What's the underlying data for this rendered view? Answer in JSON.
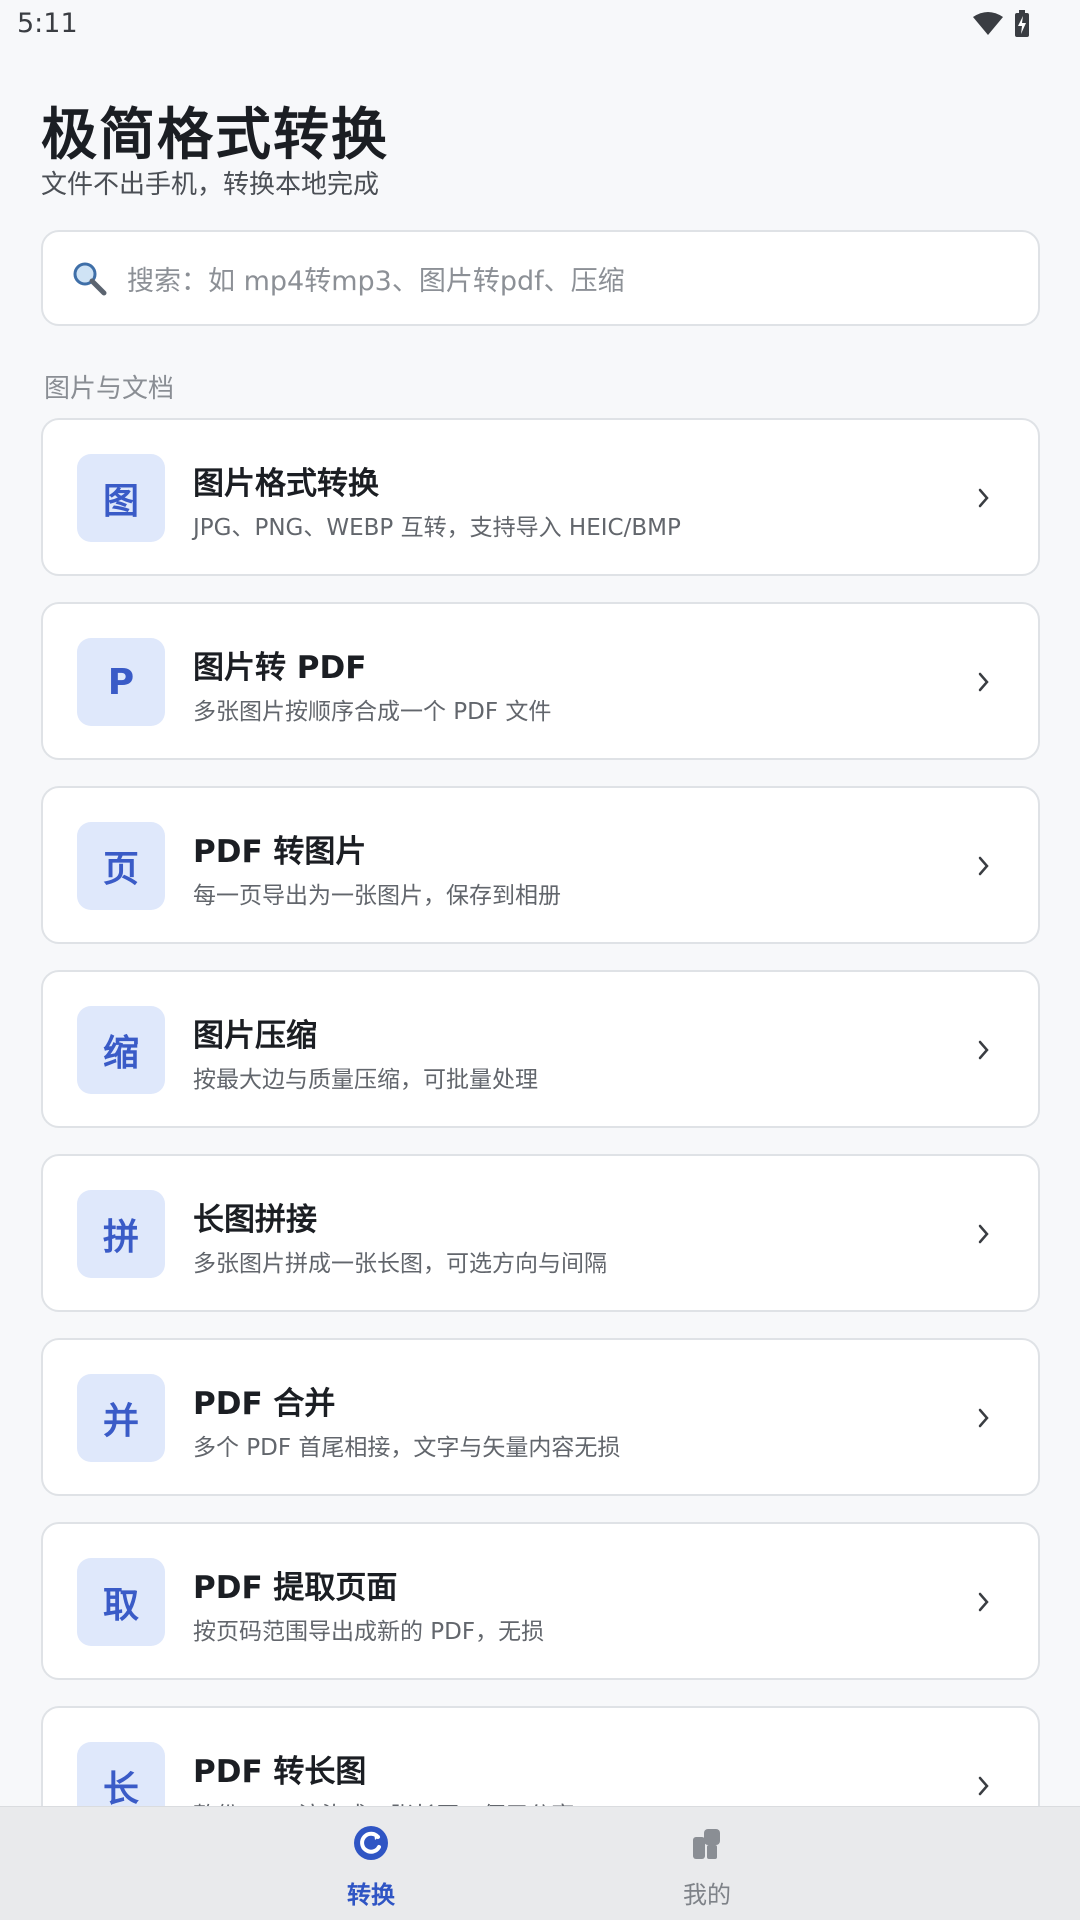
{
  "status_bar": {
    "time": "5:11"
  },
  "header": {
    "title": "极简格式转换",
    "subtitle": "文件不出手机，转换本地完成"
  },
  "search": {
    "placeholder": "搜索：如 mp4转mp3、图片转pdf、压缩"
  },
  "section": {
    "title": "图片与文档"
  },
  "tools": [
    {
      "badge": "图",
      "title": "图片格式转换",
      "desc": "JPG、PNG、WEBP 互转，支持导入 HEIC/BMP"
    },
    {
      "badge": "P",
      "title": "图片转 PDF",
      "desc": "多张图片按顺序合成一个 PDF 文件"
    },
    {
      "badge": "页",
      "title": "PDF 转图片",
      "desc": "每一页导出为一张图片，保存到相册"
    },
    {
      "badge": "缩",
      "title": "图片压缩",
      "desc": "按最大边与质量压缩，可批量处理"
    },
    {
      "badge": "拼",
      "title": "长图拼接",
      "desc": "多张图片拼成一张长图，可选方向与间隔"
    },
    {
      "badge": "并",
      "title": "PDF 合并",
      "desc": "多个 PDF 首尾相接，文字与矢量内容无损"
    },
    {
      "badge": "取",
      "title": "PDF 提取页面",
      "desc": "按页码范围导出成新的 PDF，无损"
    },
    {
      "badge": "长",
      "title": "PDF 转长图",
      "desc": "整份 PDF 渲染成一张长图，便于分享"
    }
  ],
  "bottom_nav": {
    "convert_label": "转换",
    "mine_label": "我的"
  },
  "colors": {
    "accent": "#2f55c4",
    "badge_bg": "#dfe8fb",
    "inactive": "#7e8288"
  },
  "icons": {
    "search": "search-icon",
    "chevron": "chevron-right-icon",
    "convert_tab": "refresh-icon",
    "mine_tab": "user-icon"
  }
}
